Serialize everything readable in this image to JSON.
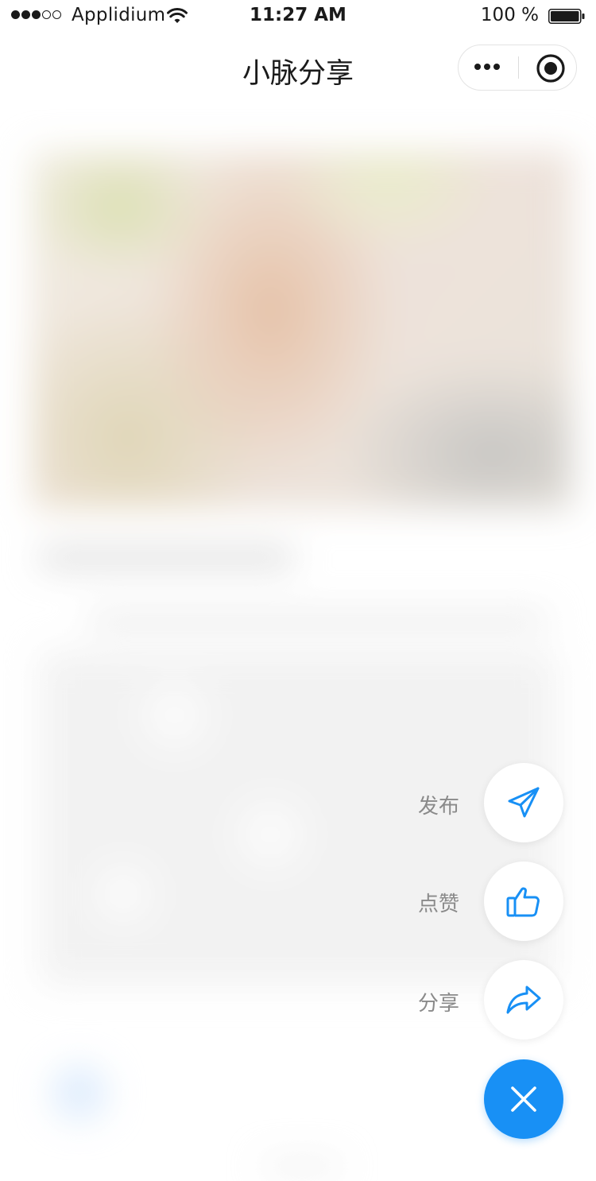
{
  "status_bar": {
    "carrier": "Applidium",
    "time": "11:27 AM",
    "battery_percent": "100 %",
    "signal_bars_filled": 3,
    "signal_bars_total": 5,
    "battery_level": 1.0,
    "icons": [
      "wifi-icon",
      "battery-icon"
    ]
  },
  "nav": {
    "title": "小脉分享",
    "capsule_icons": [
      "more-dots-icon",
      "close-target-icon"
    ]
  },
  "fab_menu": {
    "items": [
      {
        "label": "发布",
        "icon": "paper-plane-icon"
      },
      {
        "label": "点赞",
        "icon": "thumbs-up-icon"
      },
      {
        "label": "分享",
        "icon": "share-arrow-icon"
      }
    ],
    "toggle_icon": "close-icon"
  },
  "colors": {
    "accent": "#1890f5",
    "label_gray": "#8a8a8a"
  }
}
